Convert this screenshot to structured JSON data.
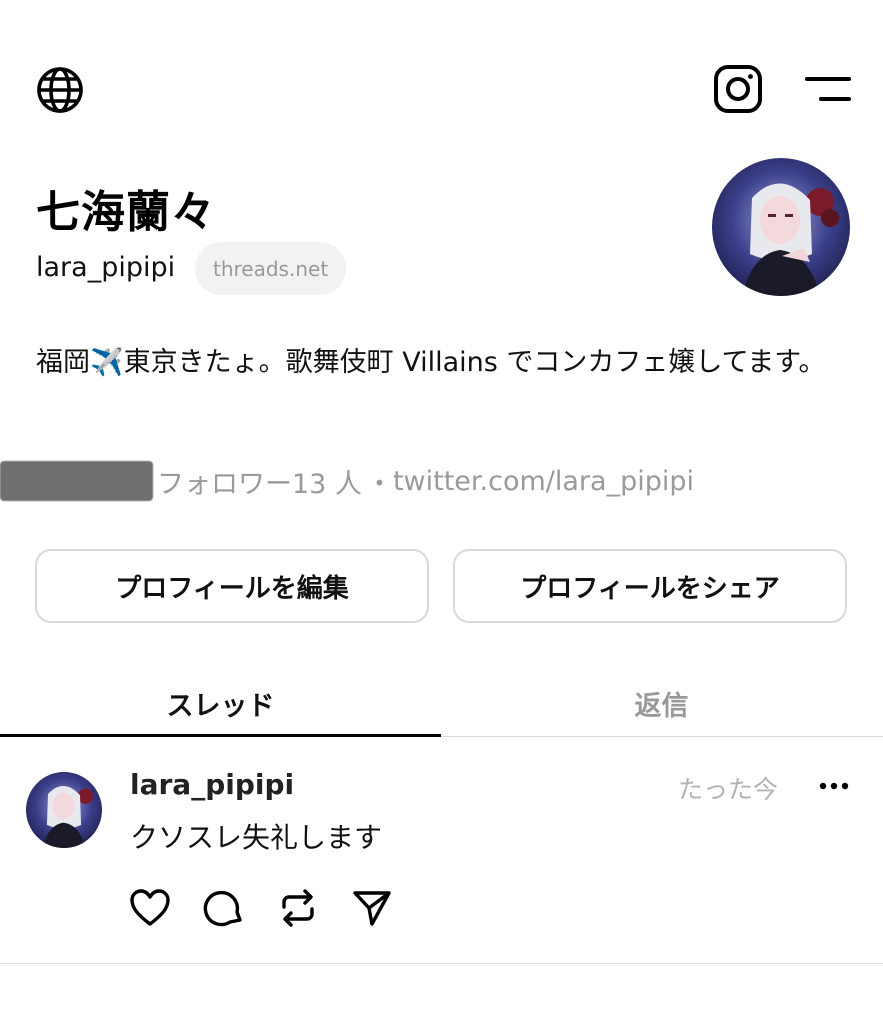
{
  "topbar": {
    "left_icon": "globe-icon",
    "right_icons": [
      "instagram-icon",
      "menu-icon"
    ]
  },
  "profile": {
    "display_name": "七海蘭々",
    "username": "lara_pipipi",
    "domain_chip": "threads.net",
    "bio_before": "福岡",
    "bio_emoji": "✈️",
    "bio_after": "東京きたょ。歌舞伎町 Villains でコンカフェ嬢してます。",
    "followers_label": "フォロワー13 人",
    "separator": "・",
    "link": "twitter.com/lara_pipipi"
  },
  "buttons": {
    "edit_profile": "プロフィールを編集",
    "share_profile": "プロフィールをシェア"
  },
  "tabs": {
    "threads": "スレッド",
    "replies": "返信"
  },
  "post": {
    "username": "lara_pipipi",
    "time": "たった今",
    "text": "クソスレ失礼します",
    "actions": [
      "heart-icon",
      "comment-icon",
      "repost-icon",
      "send-icon"
    ]
  },
  "colors": {
    "accent": "#000000",
    "muted": "#999999",
    "chip_bg": "#f2f2f2",
    "border": "#d9d9d9"
  }
}
